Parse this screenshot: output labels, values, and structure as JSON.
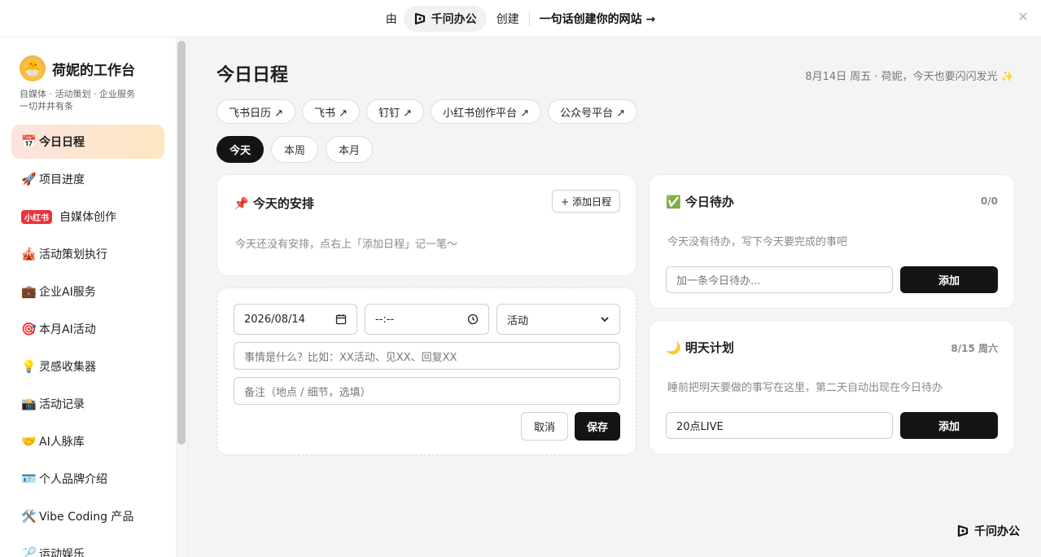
{
  "banner": {
    "by": "由",
    "brand": "千问办公",
    "create": "创建",
    "cta": "一句话创建你的网站 →",
    "close_icon": "close-icon"
  },
  "sidebar": {
    "avatar_icon": "cute-bun-emoji",
    "title": "荷妮的工作台",
    "sub1": "自媒体 · 活动策划 · 企业服务",
    "sub2": "一切井井有条",
    "items": [
      {
        "icon": "📅",
        "label": "今日日程",
        "active": true
      },
      {
        "icon": "🚀",
        "label": "项目进度"
      },
      {
        "tag": "小红书",
        "label": "自媒体创作"
      },
      {
        "icon": "🎪",
        "label": "活动策划执行"
      },
      {
        "icon": "💼",
        "label": "企业AI服务"
      },
      {
        "icon": "🎯",
        "label": "本月AI活动"
      },
      {
        "icon": "💡",
        "label": "灵感收集器"
      },
      {
        "icon": "📸",
        "label": "活动记录"
      },
      {
        "icon": "🤝",
        "label": "AI人脉库"
      },
      {
        "icon": "🪪",
        "label": "个人品牌介绍"
      },
      {
        "icon": "🛠️",
        "label": "Vibe Coding 产品"
      },
      {
        "icon": "🏸",
        "label": "运动娱乐"
      }
    ]
  },
  "main": {
    "title": "今日日程",
    "greeting": "8月14日 周五 · 荷妮，今天也要闪闪发光 ✨",
    "links": [
      "飞书日历 ↗",
      "飞书 ↗",
      "钉钉 ↗",
      "小红书创作平台 ↗",
      "公众号平台 ↗"
    ],
    "tabs": [
      "今天",
      "本周",
      "本月"
    ],
    "schedule": {
      "title": "📌 今天的安排",
      "add_button": "+ 添加日程",
      "empty": "今天还没有安排，点右上「添加日程」记一笔～"
    },
    "form": {
      "date": "2026/08/14",
      "time": "--:--",
      "category": "活动",
      "what_placeholder": "事情是什么？比如：XX活动、见XX、回复XX",
      "note_placeholder": "备注（地点 / 细节，选填）",
      "cancel": "取消",
      "save": "保存"
    },
    "todo": {
      "title": "✅ 今日待办",
      "count": "0/0",
      "empty": "今天没有待办，写下今天要完成的事吧",
      "input_placeholder": "加一条今日待办...",
      "add": "添加"
    },
    "tomorrow": {
      "title": "🌙 明天计划",
      "date": "8/15 周六",
      "hint": "睡前把明天要做的事写在这里，第二天自动出现在今日待办",
      "input_value": "20点LIVE",
      "add": "添加"
    },
    "footer_brand": "千问办公"
  }
}
